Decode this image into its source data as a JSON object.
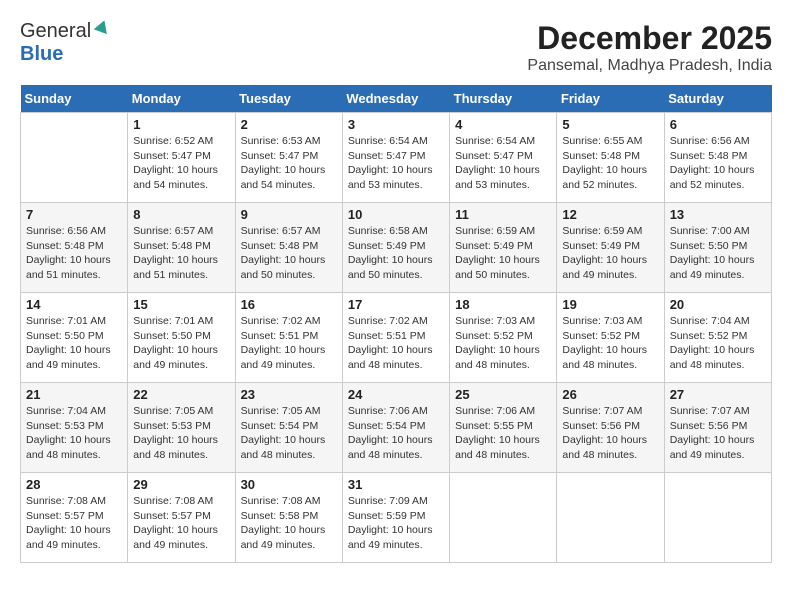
{
  "header": {
    "logo_general": "General",
    "logo_blue": "Blue",
    "title": "December 2025",
    "subtitle": "Pansemal, Madhya Pradesh, India"
  },
  "calendar": {
    "days_of_week": [
      "Sunday",
      "Monday",
      "Tuesday",
      "Wednesday",
      "Thursday",
      "Friday",
      "Saturday"
    ],
    "weeks": [
      [
        {
          "day": "",
          "info": ""
        },
        {
          "day": "1",
          "info": "Sunrise: 6:52 AM\nSunset: 5:47 PM\nDaylight: 10 hours\nand 54 minutes."
        },
        {
          "day": "2",
          "info": "Sunrise: 6:53 AM\nSunset: 5:47 PM\nDaylight: 10 hours\nand 54 minutes."
        },
        {
          "day": "3",
          "info": "Sunrise: 6:54 AM\nSunset: 5:47 PM\nDaylight: 10 hours\nand 53 minutes."
        },
        {
          "day": "4",
          "info": "Sunrise: 6:54 AM\nSunset: 5:47 PM\nDaylight: 10 hours\nand 53 minutes."
        },
        {
          "day": "5",
          "info": "Sunrise: 6:55 AM\nSunset: 5:48 PM\nDaylight: 10 hours\nand 52 minutes."
        },
        {
          "day": "6",
          "info": "Sunrise: 6:56 AM\nSunset: 5:48 PM\nDaylight: 10 hours\nand 52 minutes."
        }
      ],
      [
        {
          "day": "7",
          "info": "Sunrise: 6:56 AM\nSunset: 5:48 PM\nDaylight: 10 hours\nand 51 minutes."
        },
        {
          "day": "8",
          "info": "Sunrise: 6:57 AM\nSunset: 5:48 PM\nDaylight: 10 hours\nand 51 minutes."
        },
        {
          "day": "9",
          "info": "Sunrise: 6:57 AM\nSunset: 5:48 PM\nDaylight: 10 hours\nand 50 minutes."
        },
        {
          "day": "10",
          "info": "Sunrise: 6:58 AM\nSunset: 5:49 PM\nDaylight: 10 hours\nand 50 minutes."
        },
        {
          "day": "11",
          "info": "Sunrise: 6:59 AM\nSunset: 5:49 PM\nDaylight: 10 hours\nand 50 minutes."
        },
        {
          "day": "12",
          "info": "Sunrise: 6:59 AM\nSunset: 5:49 PM\nDaylight: 10 hours\nand 49 minutes."
        },
        {
          "day": "13",
          "info": "Sunrise: 7:00 AM\nSunset: 5:50 PM\nDaylight: 10 hours\nand 49 minutes."
        }
      ],
      [
        {
          "day": "14",
          "info": "Sunrise: 7:01 AM\nSunset: 5:50 PM\nDaylight: 10 hours\nand 49 minutes."
        },
        {
          "day": "15",
          "info": "Sunrise: 7:01 AM\nSunset: 5:50 PM\nDaylight: 10 hours\nand 49 minutes."
        },
        {
          "day": "16",
          "info": "Sunrise: 7:02 AM\nSunset: 5:51 PM\nDaylight: 10 hours\nand 49 minutes."
        },
        {
          "day": "17",
          "info": "Sunrise: 7:02 AM\nSunset: 5:51 PM\nDaylight: 10 hours\nand 48 minutes."
        },
        {
          "day": "18",
          "info": "Sunrise: 7:03 AM\nSunset: 5:52 PM\nDaylight: 10 hours\nand 48 minutes."
        },
        {
          "day": "19",
          "info": "Sunrise: 7:03 AM\nSunset: 5:52 PM\nDaylight: 10 hours\nand 48 minutes."
        },
        {
          "day": "20",
          "info": "Sunrise: 7:04 AM\nSunset: 5:52 PM\nDaylight: 10 hours\nand 48 minutes."
        }
      ],
      [
        {
          "day": "21",
          "info": "Sunrise: 7:04 AM\nSunset: 5:53 PM\nDaylight: 10 hours\nand 48 minutes."
        },
        {
          "day": "22",
          "info": "Sunrise: 7:05 AM\nSunset: 5:53 PM\nDaylight: 10 hours\nand 48 minutes."
        },
        {
          "day": "23",
          "info": "Sunrise: 7:05 AM\nSunset: 5:54 PM\nDaylight: 10 hours\nand 48 minutes."
        },
        {
          "day": "24",
          "info": "Sunrise: 7:06 AM\nSunset: 5:54 PM\nDaylight: 10 hours\nand 48 minutes."
        },
        {
          "day": "25",
          "info": "Sunrise: 7:06 AM\nSunset: 5:55 PM\nDaylight: 10 hours\nand 48 minutes."
        },
        {
          "day": "26",
          "info": "Sunrise: 7:07 AM\nSunset: 5:56 PM\nDaylight: 10 hours\nand 48 minutes."
        },
        {
          "day": "27",
          "info": "Sunrise: 7:07 AM\nSunset: 5:56 PM\nDaylight: 10 hours\nand 49 minutes."
        }
      ],
      [
        {
          "day": "28",
          "info": "Sunrise: 7:08 AM\nSunset: 5:57 PM\nDaylight: 10 hours\nand 49 minutes."
        },
        {
          "day": "29",
          "info": "Sunrise: 7:08 AM\nSunset: 5:57 PM\nDaylight: 10 hours\nand 49 minutes."
        },
        {
          "day": "30",
          "info": "Sunrise: 7:08 AM\nSunset: 5:58 PM\nDaylight: 10 hours\nand 49 minutes."
        },
        {
          "day": "31",
          "info": "Sunrise: 7:09 AM\nSunset: 5:59 PM\nDaylight: 10 hours\nand 49 minutes."
        },
        {
          "day": "",
          "info": ""
        },
        {
          "day": "",
          "info": ""
        },
        {
          "day": "",
          "info": ""
        }
      ]
    ]
  }
}
